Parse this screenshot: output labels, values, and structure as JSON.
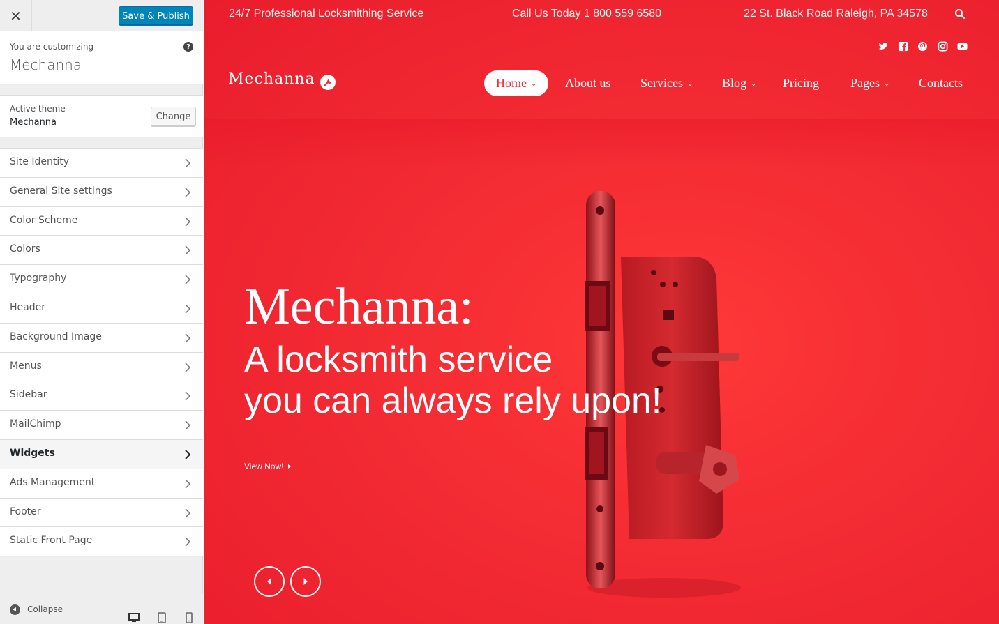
{
  "customizer": {
    "close_glyph": "✕",
    "publish_label": "Save & Publish",
    "info_label": "You are customizing",
    "site_name": "Mechanna",
    "help_glyph": "?",
    "theme_label": "Active theme",
    "theme_name": "Mechanna",
    "change_label": "Change",
    "sections": [
      {
        "label": "Site Identity"
      },
      {
        "label": "General Site settings"
      },
      {
        "label": "Color Scheme"
      },
      {
        "label": "Colors"
      },
      {
        "label": "Typography"
      },
      {
        "label": "Header"
      },
      {
        "label": "Background Image"
      },
      {
        "label": "Menus"
      },
      {
        "label": "Sidebar"
      },
      {
        "label": "MailChimp"
      },
      {
        "label": "Widgets",
        "active": true
      },
      {
        "label": "Ads Management"
      },
      {
        "label": "Footer"
      },
      {
        "label": "Static Front Page"
      }
    ],
    "collapse_label": "Collapse",
    "devices": [
      "desktop-icon",
      "tablet-icon",
      "mobile-icon"
    ],
    "accent_color": "#0085ba"
  },
  "site": {
    "tagline_left": "24/7 Professional Locksmithing Service",
    "tagline_phone": "Call Us Today 1 800 559 6580",
    "tagline_address": "22 St. Black Road Raleigh, PA 34578",
    "social": [
      "twitter-icon",
      "facebook-icon",
      "pinterest-icon",
      "instagram-icon",
      "youtube-icon"
    ],
    "logo": "Mechanna",
    "nav": [
      {
        "label": "Home",
        "caret": "⌄",
        "active": true
      },
      {
        "label": "About us"
      },
      {
        "label": "Services",
        "caret": "⌄"
      },
      {
        "label": "Blog",
        "caret": "⌄"
      },
      {
        "label": "Pricing"
      },
      {
        "label": "Pages",
        "caret": "⌄"
      },
      {
        "label": "Contacts"
      }
    ],
    "hero": {
      "title": "Mechanna:",
      "line1": "A locksmith service",
      "line2": "you can always rely upon!",
      "cta": "View Now!"
    },
    "brand_color": "#ef2b34"
  }
}
